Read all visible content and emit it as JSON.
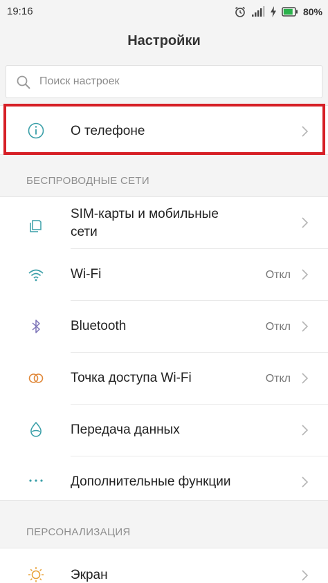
{
  "status_bar": {
    "time": "19:16",
    "battery_percent": "80%",
    "icons": [
      "alarm-icon",
      "signal-icon",
      "charging-icon",
      "battery-icon"
    ]
  },
  "header": {
    "title": "Настройки"
  },
  "search": {
    "placeholder": "Поиск настроек",
    "value": ""
  },
  "about": {
    "label": "О телефоне",
    "icon": "info-icon"
  },
  "sections": {
    "wireless": {
      "title": "БЕСПРОВОДНЫЕ СЕТИ",
      "items": [
        {
          "label_line1": "SIM-карты и мобильные",
          "label_line2": "сети",
          "icon": "sim-cards-icon",
          "value": ""
        },
        {
          "label": "Wi-Fi",
          "icon": "wifi-icon",
          "value": "Откл"
        },
        {
          "label": "Bluetooth",
          "icon": "bluetooth-icon",
          "value": "Откл"
        },
        {
          "label": "Точка доступа Wi-Fi",
          "icon": "hotspot-icon",
          "value": "Откл"
        },
        {
          "label": "Передача данных",
          "icon": "data-usage-icon",
          "value": ""
        },
        {
          "label": "Дополнительные функции",
          "icon": "more-dots-icon",
          "value": ""
        }
      ]
    },
    "personalization": {
      "title": "ПЕРСОНАЛИЗАЦИЯ",
      "items": [
        {
          "label": "Экран",
          "icon": "display-icon",
          "value": ""
        }
      ]
    }
  },
  "colors": {
    "highlight": "#d61f26",
    "accent_teal": "#3a9fa8",
    "background": "#f4f4f4",
    "battery_fill": "#2bb24c"
  }
}
